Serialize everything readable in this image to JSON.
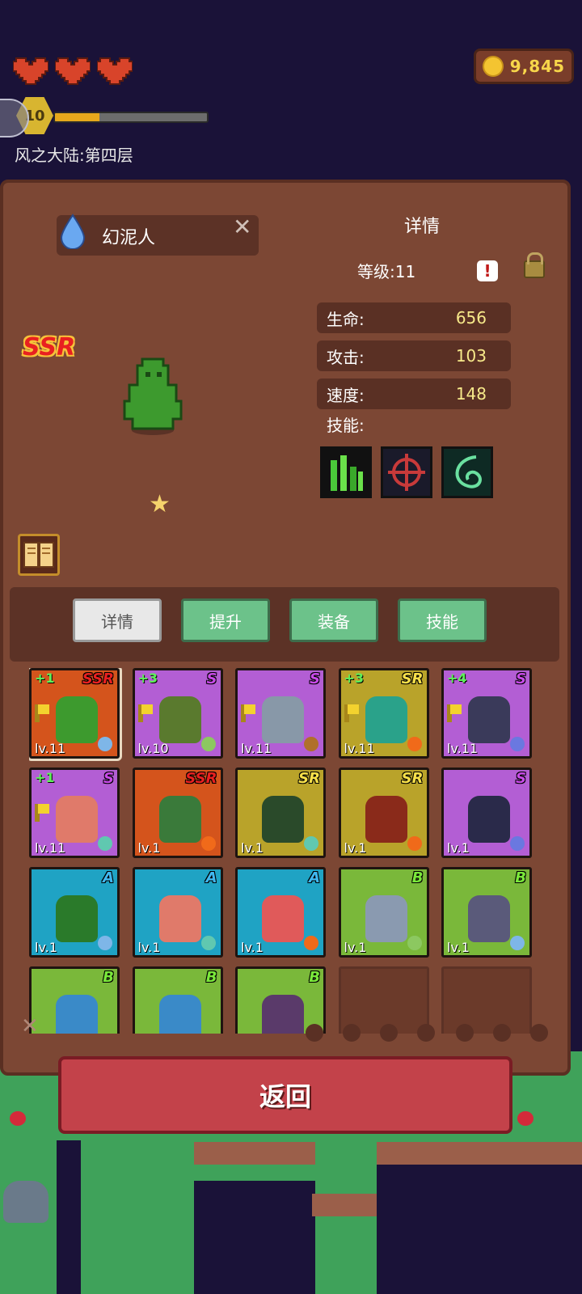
{
  "hud": {
    "hearts": 3,
    "coins": "9,845",
    "player_level": "10",
    "xp_progress": 0.29,
    "area_name": "风之大陆:第四层"
  },
  "detail": {
    "monster_name": "幻泥人",
    "close_label": "✕",
    "title": "详情",
    "level_label": "等级:11",
    "rarity": "SSR",
    "stars": 1,
    "stats": [
      {
        "label": "生命:",
        "value": "656"
      },
      {
        "label": "攻击:",
        "value": "103"
      },
      {
        "label": "速度:",
        "value": "148"
      }
    ],
    "skills_label": "技能:",
    "skills": [
      "bamboo-spikes-skill-icon",
      "crosshair-skill-icon",
      "wind-slash-skill-icon"
    ]
  },
  "tabs": [
    {
      "label": "详情",
      "active": true
    },
    {
      "label": "提升",
      "active": false
    },
    {
      "label": "装备",
      "active": false
    },
    {
      "label": "技能",
      "active": false
    }
  ],
  "roster": [
    {
      "plus": "+1",
      "rank": "SSR",
      "level": "lv.11",
      "bg": "#d4541c",
      "sprite": "#3d9a2e",
      "flag": true,
      "element": "#7eb6e8",
      "selected": true
    },
    {
      "plus": "+3",
      "rank": "S",
      "level": "lv.10",
      "bg": "#b35ed4",
      "sprite": "#5a7a2e",
      "flag": true,
      "element": "#8cc860"
    },
    {
      "plus": "",
      "rank": "S",
      "level": "lv.11",
      "bg": "#b35ed4",
      "sprite": "#8898a8",
      "flag": true,
      "element": "#b0702a"
    },
    {
      "plus": "+3",
      "rank": "SR",
      "level": "lv.11",
      "bg": "#b9a32a",
      "sprite": "#2aa28a",
      "flag": true,
      "element": "#f06a1a"
    },
    {
      "plus": "+4",
      "rank": "S",
      "level": "lv.11",
      "bg": "#b35ed4",
      "sprite": "#3a3a5a",
      "flag": true,
      "element": "#6a78e0"
    },
    {
      "plus": "+1",
      "rank": "S",
      "level": "lv.11",
      "bg": "#b35ed4",
      "sprite": "#e07a6a",
      "flag": true,
      "element": "#60c8b0"
    },
    {
      "plus": "",
      "rank": "SSR",
      "level": "lv.1",
      "bg": "#d4541c",
      "sprite": "#3a7a3a",
      "flag": false,
      "element": "#f06a1a"
    },
    {
      "plus": "",
      "rank": "SR",
      "level": "lv.1",
      "bg": "#b9a32a",
      "sprite": "#2a4a2a",
      "flag": false,
      "element": "#60c8b0"
    },
    {
      "plus": "",
      "rank": "SR",
      "level": "lv.1",
      "bg": "#b9a32a",
      "sprite": "#8a2a1a",
      "flag": false,
      "element": "#f06a1a"
    },
    {
      "plus": "",
      "rank": "S",
      "level": "lv.1",
      "bg": "#b35ed4",
      "sprite": "#2a2a4a",
      "flag": false,
      "element": "#6a78e0"
    },
    {
      "plus": "",
      "rank": "A",
      "level": "lv.1",
      "bg": "#1fa3c4",
      "sprite": "#2a7a2a",
      "flag": false,
      "element": "#7eb6e8"
    },
    {
      "plus": "",
      "rank": "A",
      "level": "lv.1",
      "bg": "#1fa3c4",
      "sprite": "#e07a6a",
      "flag": false,
      "element": "#60c8b0"
    },
    {
      "plus": "",
      "rank": "A",
      "level": "lv.1",
      "bg": "#1fa3c4",
      "sprite": "#e05a5a",
      "flag": false,
      "element": "#f06a1a"
    },
    {
      "plus": "",
      "rank": "B",
      "level": "lv.1",
      "bg": "#7ab83a",
      "sprite": "#8a9ab0",
      "flag": false,
      "element": "#8cc860"
    },
    {
      "plus": "",
      "rank": "B",
      "level": "lv.1",
      "bg": "#7ab83a",
      "sprite": "#5a5a7a",
      "flag": false,
      "element": "#7eb6e8"
    },
    {
      "plus": "",
      "rank": "B",
      "level": "",
      "bg": "#7ab83a",
      "sprite": "#3a8ac8",
      "flag": false,
      "element": ""
    },
    {
      "plus": "",
      "rank": "B",
      "level": "",
      "bg": "#7ab83a",
      "sprite": "#3a8ac8",
      "flag": false,
      "element": ""
    },
    {
      "plus": "",
      "rank": "B",
      "level": "",
      "bg": "#7ab83a",
      "sprite": "#5a3a6a",
      "flag": false,
      "element": ""
    },
    {
      "empty": true
    },
    {
      "empty": true
    }
  ],
  "filters": [
    "fire-filter-icon",
    "earth-filter-icon",
    "water-filter-icon",
    "wind-filter-icon",
    "flame-filter-icon",
    "gear-filter-icon",
    "refresh-filter-icon"
  ],
  "back_button": "返回"
}
